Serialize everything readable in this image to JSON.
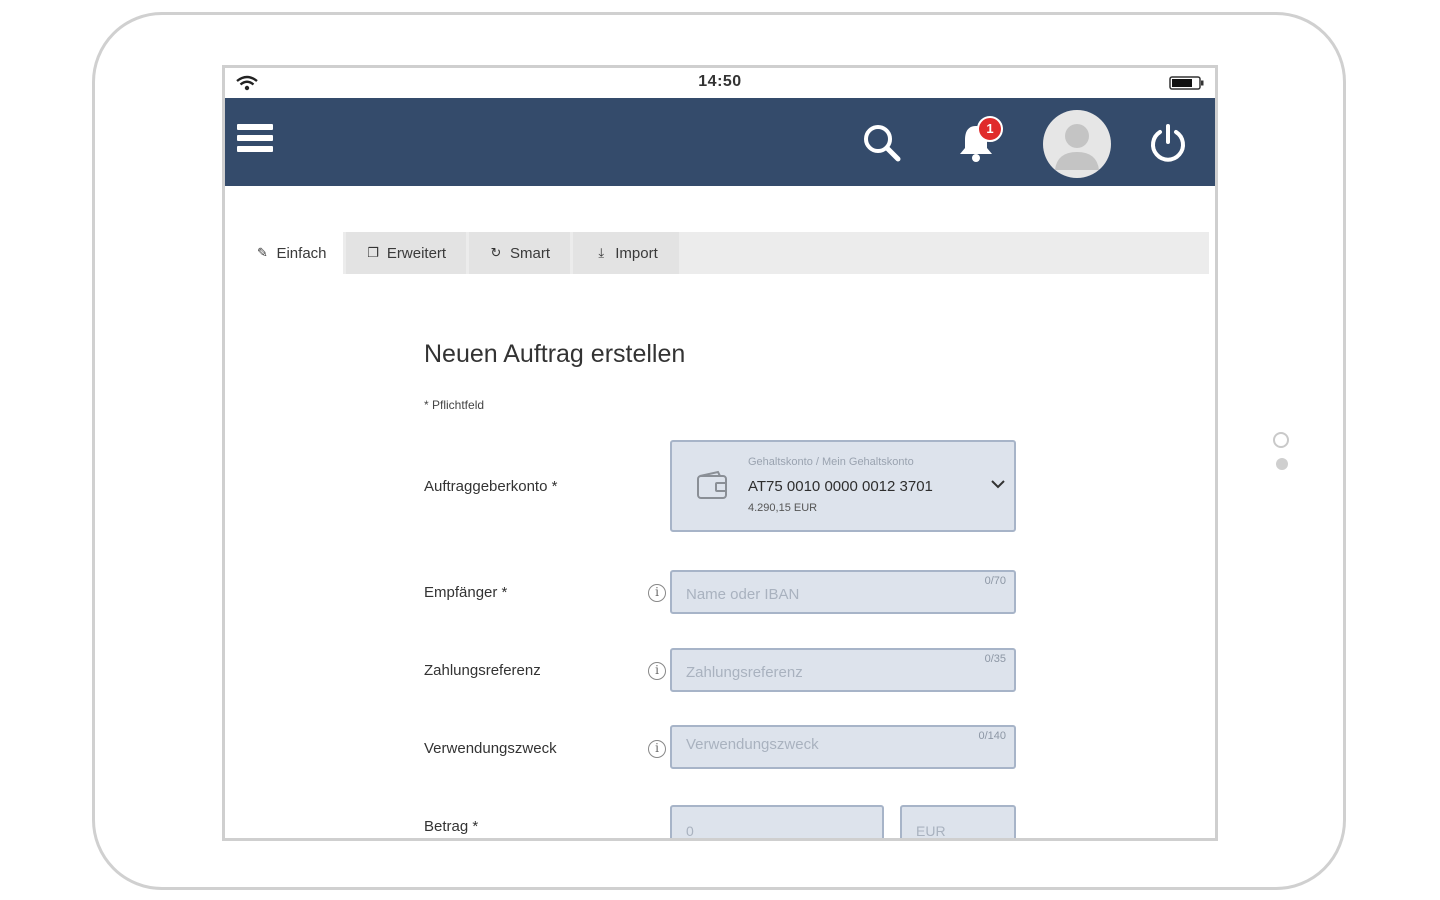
{
  "statusbar": {
    "time": "14:50"
  },
  "appbar": {
    "notification_count": "1",
    "icons": [
      "menu-icon",
      "search-icon",
      "bell-icon",
      "avatar",
      "power-icon"
    ],
    "color": "#344b6b"
  },
  "tabs": [
    {
      "label": "Einfach",
      "icon": "edit-icon",
      "active": true
    },
    {
      "label": "Erweitert",
      "icon": "copy-icon",
      "active": false
    },
    {
      "label": "Smart",
      "icon": "smart-icon",
      "active": false
    },
    {
      "label": "Import",
      "icon": "import-icon",
      "active": false
    }
  ],
  "form": {
    "title": "Neuen Auftrag erstellen",
    "required_note": "* Pflichtfeld",
    "auftraggeberkonto": {
      "label": "Auftraggeberkonto *",
      "account_name": "Gehaltskonto / Mein Gehaltskonto",
      "iban": "AT75 0010 0000 0012 3701",
      "balance": "4.290,15 EUR"
    },
    "empfaenger": {
      "label": "Empfänger *",
      "placeholder": "Name oder IBAN",
      "counter": "0/70"
    },
    "zahlungsreferenz": {
      "label": "Zahlungsreferenz",
      "placeholder": "Zahlungsreferenz",
      "counter": "0/35"
    },
    "verwendungszweck": {
      "label": "Verwendungszweck",
      "placeholder": "Verwendungszweck",
      "counter": "0/140"
    },
    "betrag": {
      "label": "Betrag *",
      "amount_placeholder": "0",
      "currency": "EUR"
    }
  },
  "colors": {
    "field_bg": "#dde3ec",
    "field_border": "#a7b4c8",
    "badge": "#e02b2b"
  }
}
